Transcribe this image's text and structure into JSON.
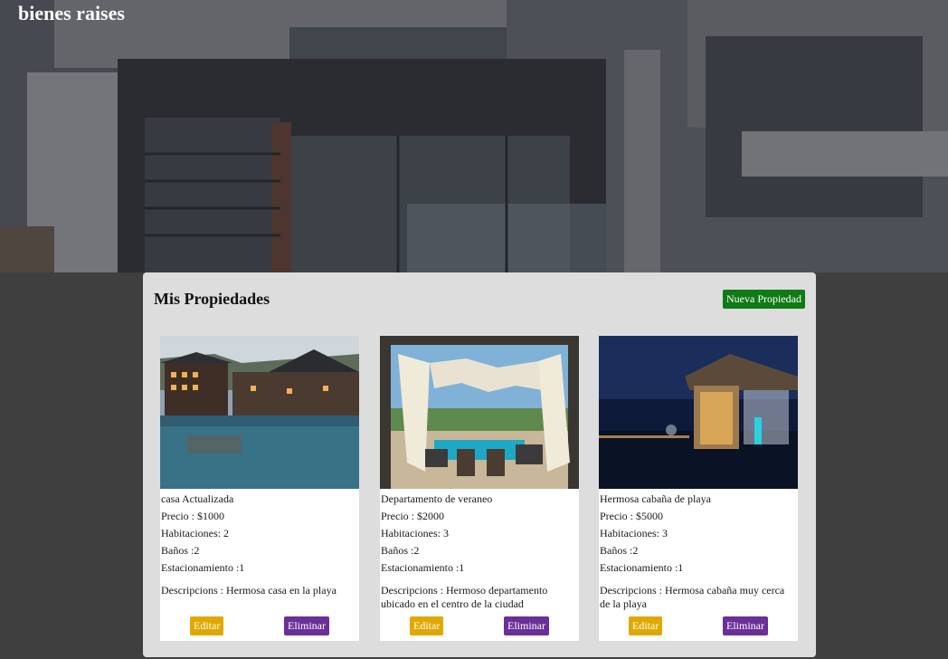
{
  "site": {
    "title": "bienes raises"
  },
  "panel": {
    "title": "Mis Propiedades",
    "new_button": "Nueva Propiedad"
  },
  "properties": [
    {
      "title": "casa Actualizada",
      "price": "Precio : $1000",
      "rooms": "Habitaciones: 2",
      "baths": "Baños :2",
      "parking": "Estacionamiento :1",
      "description": "Descripcions : Hermosa casa en la playa",
      "edit": "Editar",
      "delete": "Eliminar"
    },
    {
      "title": "Departamento de veraneo",
      "price": "Precio : $2000",
      "rooms": "Habitaciones: 3",
      "baths": "Baños :2",
      "parking": "Estacionamiento :1",
      "description": "Descripcions : Hermoso departamento ubicado en el centro de la ciudad",
      "edit": "Editar",
      "delete": "Eliminar"
    },
    {
      "title": "Hermosa cabaña de playa",
      "price": "Precio : $5000",
      "rooms": "Habitaciones: 3",
      "baths": "Baños :2",
      "parking": "Estacionamiento :1",
      "description": "Descripcions : Hermosa cabaña muy cerca de la playa",
      "edit": "Editar",
      "delete": "Eliminar"
    }
  ],
  "colors": {
    "new_button": "#0f7a16",
    "edit_button": "#e0a800",
    "delete_button": "#6a2f98",
    "panel": "#dddddd"
  }
}
